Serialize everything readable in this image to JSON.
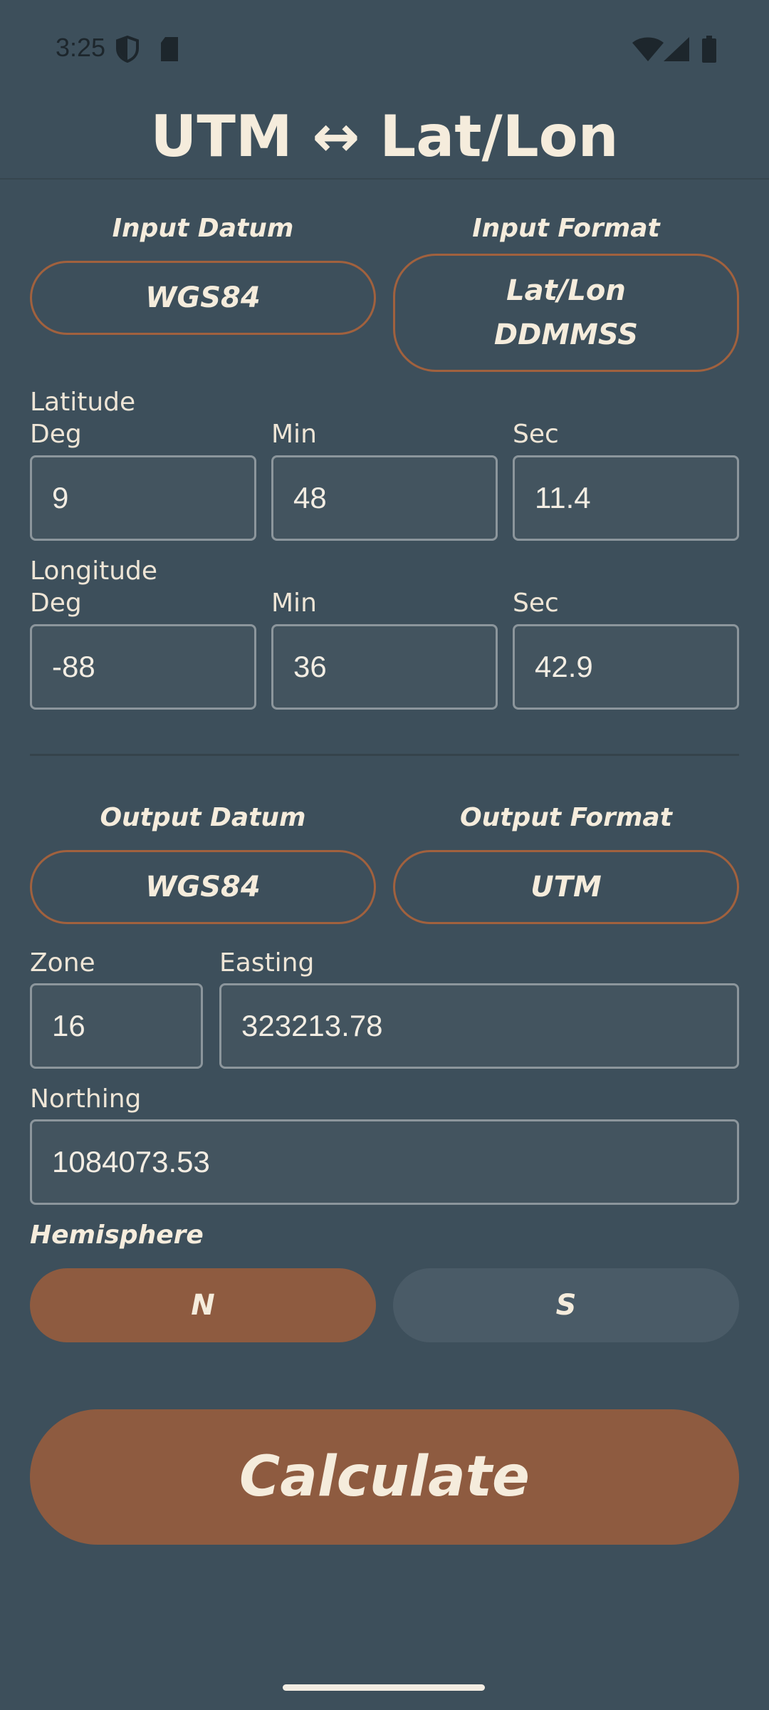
{
  "status_bar": {
    "time": "3:25",
    "icons": [
      "shield-icon",
      "sd-card-icon",
      "wifi-icon",
      "cell-signal-icon",
      "battery-icon"
    ]
  },
  "title": "UTM ↔ Lat/Lon",
  "input": {
    "datum_label": "Input Datum",
    "datum_value": "WGS84",
    "format_label": "Input Format",
    "format_value_line1": "Lat/Lon",
    "format_value_line2": "DDMMSS",
    "latitude": {
      "label": "Latitude",
      "deg_label": "Deg",
      "min_label": "Min",
      "sec_label": "Sec",
      "deg": "9",
      "min": "48",
      "sec": "11.4"
    },
    "longitude": {
      "label": "Longitude",
      "deg_label": "Deg",
      "min_label": "Min",
      "sec_label": "Sec",
      "deg": "-88",
      "min": "36",
      "sec": "42.9"
    }
  },
  "output": {
    "datum_label": "Output Datum",
    "datum_value": "WGS84",
    "format_label": "Output Format",
    "format_value": "UTM",
    "zone_label": "Zone",
    "zone": "16",
    "easting_label": "Easting",
    "easting": "323213.78",
    "northing_label": "Northing",
    "northing": "1084073.53"
  },
  "hemisphere": {
    "label": "Hemisphere",
    "north": "N",
    "south": "S",
    "selected": "N"
  },
  "calculate_label": "Calculate",
  "colors": {
    "background": "#3d4f5b",
    "accent": "#8e5b40",
    "accent_border": "#a1613e",
    "text": "#f5ecdc",
    "unselected_button": "#4a5b67"
  }
}
